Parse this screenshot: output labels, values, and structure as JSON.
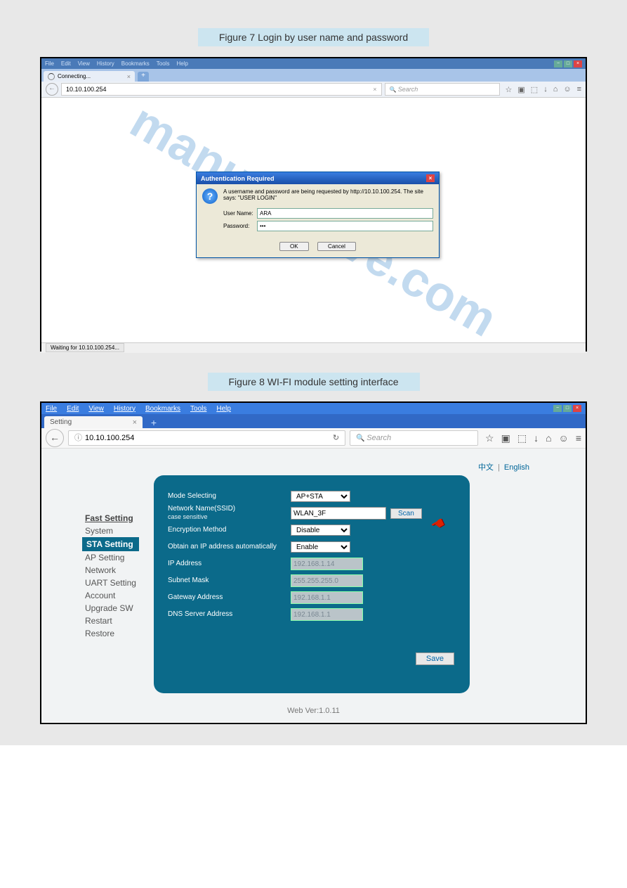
{
  "caption1": "Figure 7 Login by user name and password",
  "caption2": "Figure 8 WI-FI module setting interface",
  "shot1": {
    "menus": [
      "File",
      "Edit",
      "View",
      "History",
      "Bookmarks",
      "Tools",
      "Help"
    ],
    "tab_title": "Connecting...",
    "url": "10.10.100.254",
    "search_placeholder": "Search",
    "toolbar_icons": [
      "☆",
      "▣",
      "⬚",
      "↓",
      "⌂",
      "☺",
      "≡"
    ],
    "statusbar": "Waiting for 10.10.100.254...",
    "dialog": {
      "title": "Authentication Required",
      "message": "A username and password are being requested by http://10.10.100.254. The site says: \"USER LOGIN\"",
      "username_label": "User Name:",
      "username_value": "ARA",
      "password_label": "Password:",
      "password_value": "•••",
      "ok": "OK",
      "cancel": "Cancel"
    }
  },
  "shot2": {
    "menus": [
      "File",
      "Edit",
      "View",
      "History",
      "Bookmarks",
      "Tools",
      "Help"
    ],
    "tab_title": "Setting",
    "url": "10.10.100.254",
    "search_placeholder": "Search",
    "toolbar_icons": [
      "☆",
      "▣",
      "⬚",
      "↓",
      "⌂",
      "☺",
      "≡"
    ],
    "lang_zh": "中文",
    "lang_en": "English",
    "nav": {
      "heading": "Fast Setting",
      "items": [
        "System",
        "STA Setting",
        "AP Setting",
        "Network",
        "UART Setting",
        "Account",
        "Upgrade SW",
        "Restart",
        "Restore"
      ],
      "active_index": 1
    },
    "form": {
      "mode_label": "Mode Selecting",
      "mode_value": "AP+STA",
      "ssid_label": "Network Name(SSID)",
      "ssid_sub": "case sensitive",
      "ssid_value": "WLAN_3F",
      "scan": "Scan",
      "enc_label": "Encryption Method",
      "enc_value": "Disable",
      "dhcp_label": "Obtain an IP address automatically",
      "dhcp_value": "Enable",
      "ip_label": "IP Address",
      "ip_value": "192.168.1.14",
      "mask_label": "Subnet Mask",
      "mask_value": "255.255.255.0",
      "gw_label": "Gateway Address",
      "gw_value": "192.168.1.1",
      "dns_label": "DNS Server Address",
      "dns_value": "192.168.1.1",
      "save": "Save"
    },
    "footer": "Web Ver:1.0.11"
  },
  "watermark": "manualshive.com"
}
